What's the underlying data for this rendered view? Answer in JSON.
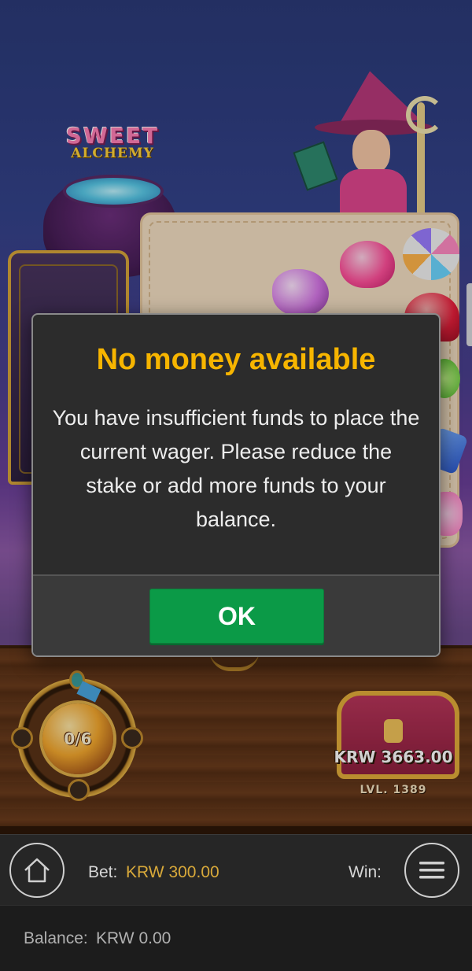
{
  "game": {
    "logo_line1": "SWEET",
    "logo_line2": "ALCHEMY",
    "meter_text": "0/6",
    "chest_amount": "KRW 3663.00",
    "chest_level": "LVL. 1389"
  },
  "dialog": {
    "title": "No money available",
    "message": "You have insufficient funds to place the current wager. Please reduce the stake or add more funds to your balance.",
    "ok_label": "OK"
  },
  "bottom_bar": {
    "bet_label": "Bet:",
    "bet_value": "KRW 300.00",
    "win_label": "Win:",
    "home_icon": "home-icon",
    "menu_icon": "hamburger-menu-icon"
  },
  "balance_bar": {
    "balance_label": "Balance:",
    "balance_value": "KRW 0.00"
  },
  "colors": {
    "dialog_title": "#f7b500",
    "ok_button": "#0b9a47",
    "bet_value": "#d8a93a"
  }
}
